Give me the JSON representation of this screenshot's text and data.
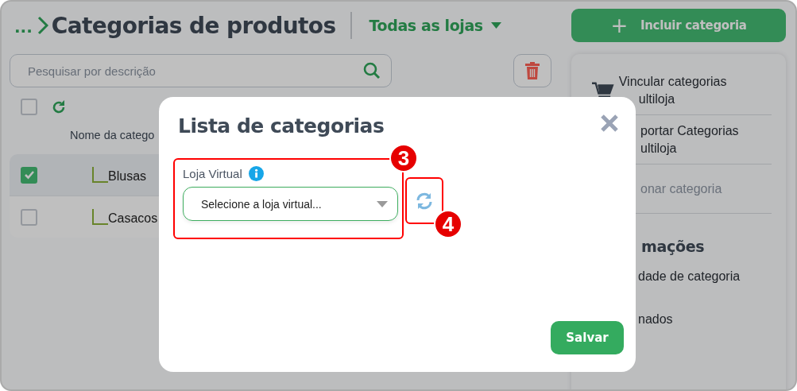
{
  "breadcrumb": {
    "ellipsis": "...",
    "title": "Categorias de produtos"
  },
  "store_filter": {
    "label": "Todas as lojas"
  },
  "add_button": {
    "icon": "+",
    "label": "Incluir categoria"
  },
  "search": {
    "placeholder": "Pesquisar por descrição"
  },
  "select_all": {
    "checked": false
  },
  "table": {
    "column_header": "Nome da catego",
    "rows": [
      {
        "name": "Blusas",
        "checked": true,
        "selected": true
      },
      {
        "name": "Casacos",
        "checked": false,
        "selected": false
      }
    ]
  },
  "side_panel": {
    "items": [
      {
        "lines": [
          "Vincular categorias",
          "ultiloja"
        ],
        "disabled": false
      },
      {
        "lines": [
          "portar Categorias",
          "ultiloja"
        ],
        "disabled": false
      },
      {
        "lines": [
          "onar categoria"
        ],
        "disabled": true
      }
    ],
    "section_title": "mações",
    "links": [
      "dade de categoria",
      "nados"
    ]
  },
  "modal": {
    "title": "Lista de categorias",
    "field": {
      "label": "Loja Virtual",
      "placeholder": "Selecione a loja virtual..."
    },
    "save_button": "Salvar"
  },
  "annotations": [
    {
      "label": "3"
    },
    {
      "label": "4"
    }
  ]
}
